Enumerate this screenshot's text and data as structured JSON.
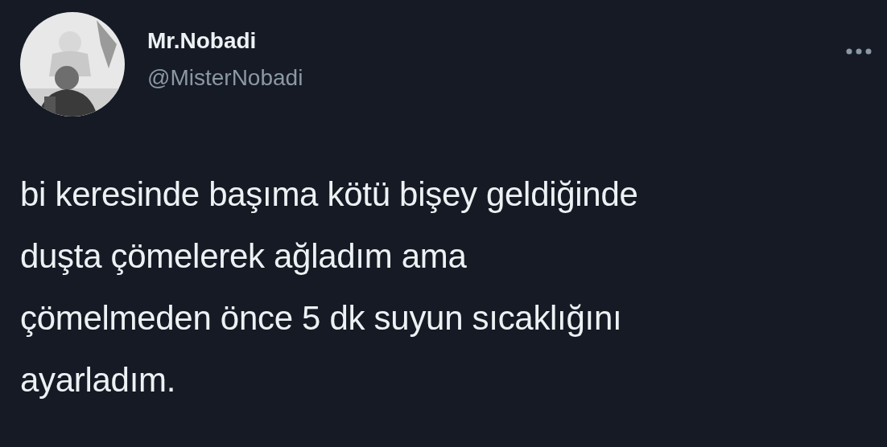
{
  "tweet": {
    "display_name": "Mr.Nobadi",
    "handle": "@MisterNobadi",
    "text": "bi keresinde başıma kötü bişey geldiğinde\nduşta çömelerek ağladım ama\nçömelmeden önce 5 dk suyun sıcaklığını\nayarladım."
  }
}
